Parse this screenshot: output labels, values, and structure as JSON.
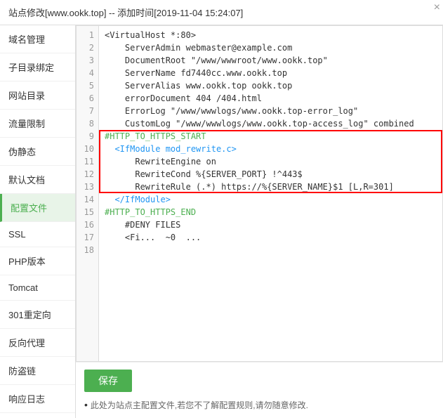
{
  "topbar": {
    "title": "站点修改[www.ookk.top] -- 添加时间[2019-11-04 15:24:07]",
    "close_icon": "×"
  },
  "sidebar": {
    "items": [
      {
        "label": "域名管理",
        "active": false
      },
      {
        "label": "子目录绑定",
        "active": false
      },
      {
        "label": "网站目录",
        "active": false
      },
      {
        "label": "流量限制",
        "active": false
      },
      {
        "label": "伪静态",
        "active": false
      },
      {
        "label": "默认文档",
        "active": false
      },
      {
        "label": "配置文件",
        "active": true
      },
      {
        "label": "SSL",
        "active": false
      },
      {
        "label": "PHP版本",
        "active": false
      },
      {
        "label": "Tomcat",
        "active": false
      },
      {
        "label": "301重定向",
        "active": false
      },
      {
        "label": "反向代理",
        "active": false
      },
      {
        "label": "防盗链",
        "active": false
      },
      {
        "label": "响应日志",
        "active": false
      }
    ]
  },
  "code": {
    "lines": [
      {
        "num": 1,
        "text": "<VirtualHost *:80>"
      },
      {
        "num": 2,
        "text": "    ServerAdmin webmaster@example.com"
      },
      {
        "num": 3,
        "text": "    DocumentRoot \"/www/wwwroot/www.ookk.top\""
      },
      {
        "num": 4,
        "text": "    ServerName fd7440cc.www.ookk.top"
      },
      {
        "num": 5,
        "text": "    ServerAlias www.ookk.top ookk.top"
      },
      {
        "num": 6,
        "text": "    errorDocument 404 /404.html"
      },
      {
        "num": 7,
        "text": "    ErrorLog \"/www/wwwlogs/www.ookk.top-error_log\""
      },
      {
        "num": 8,
        "text": "    CustomLog \"/www/wwwlogs/www.ookk.top-access_log\" combined"
      },
      {
        "num": 9,
        "text": "#HTTP_TO_HTTPS_START"
      },
      {
        "num": 10,
        "text": "  <IfModule mod_rewrite.c>"
      },
      {
        "num": 11,
        "text": "      RewriteEngine on"
      },
      {
        "num": 12,
        "text": "      RewriteCond %{SERVER_PORT} !^443$"
      },
      {
        "num": 13,
        "text": "      RewriteRule (.*) https://%{SERVER_NAME}$1 [L,R=301]"
      },
      {
        "num": 14,
        "text": "  </IfModule>"
      },
      {
        "num": 15,
        "text": "#HTTP_TO_HTTPS_END"
      },
      {
        "num": 16,
        "text": ""
      },
      {
        "num": 17,
        "text": "    #DENY FILES"
      },
      {
        "num": 18,
        "text": "    <Fi...  ~0  ..."
      }
    ]
  },
  "buttons": {
    "save": "保存"
  },
  "tip": "此处为站点主配置文件,若您不了解配置规则,请勿随意修改."
}
